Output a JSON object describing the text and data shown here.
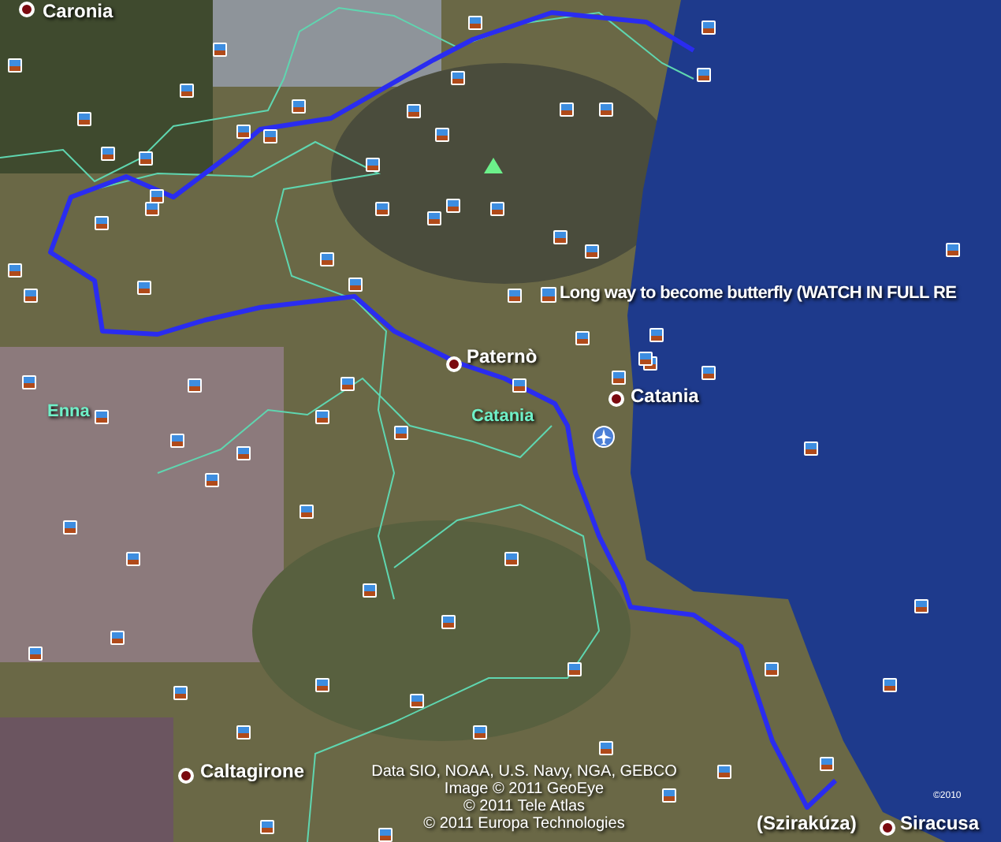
{
  "map": {
    "labels": [
      {
        "kind": "city",
        "text": "Caronia"
      },
      {
        "kind": "city",
        "text": "Paternò"
      },
      {
        "kind": "city",
        "text": "Catania"
      },
      {
        "kind": "province",
        "text": "Catania"
      },
      {
        "kind": "province",
        "text": "Enna"
      },
      {
        "kind": "city",
        "text": "Caltagirone"
      },
      {
        "kind": "plain",
        "text": "(Szirakúza)"
      },
      {
        "kind": "city",
        "text": "Siracusa"
      },
      {
        "kind": "photo",
        "text": "Long way to become butterfly (WATCH IN FULL RE"
      }
    ],
    "attribution": [
      "Data SIO, NOAA, U.S. Navy, NGA, GEBCO",
      "Image © 2011 GeoEye",
      "© 2011 Tele Atlas",
      "© 2011 Europa Technologies"
    ],
    "copyright": "©2010"
  }
}
